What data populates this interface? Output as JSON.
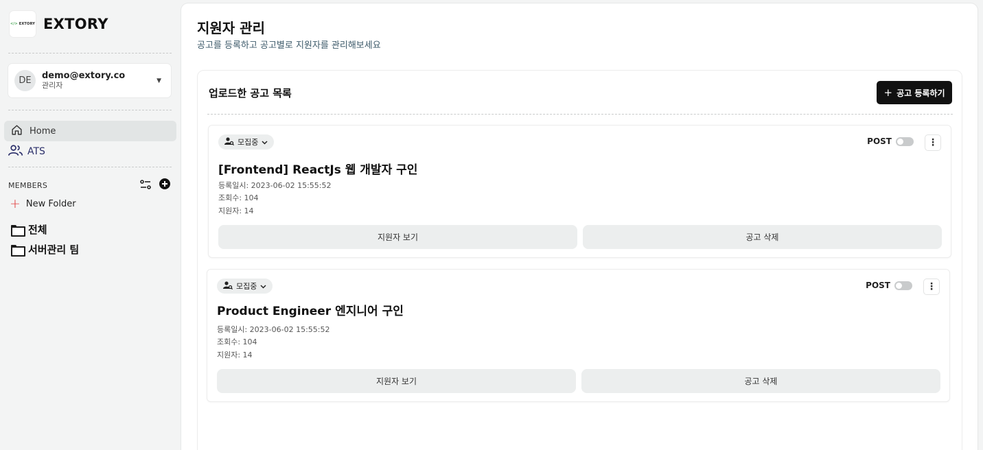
{
  "brand": {
    "logo_text": "EXTORY",
    "logo_mark": "</> EXTORY"
  },
  "user": {
    "initials": "DE",
    "email": "demo@extory.co",
    "role": "관리자"
  },
  "nav": {
    "home_label": "Home",
    "ats_label": "ATS"
  },
  "members": {
    "title": "MEMBERS",
    "new_folder_label": "New Folder",
    "folders": [
      "전체",
      "서버관리 팀"
    ]
  },
  "page": {
    "title": "지원자 관리",
    "subtitle": "공고를 등록하고 공고별로 지원자를 관리해보세요"
  },
  "panel": {
    "title": "업로드한 공고 목록",
    "add_button_label": "공고 등록하기",
    "add_button_plus": "+"
  },
  "jobs": [
    {
      "status": "모집중",
      "title": "[Frontend] ReactJs 웹 개발자 구인",
      "registered": "등록일시: 2023-06-02 15:55:52",
      "views": "조회수: 104",
      "applicants": "지원자: 14",
      "post_label": "POST",
      "post_enabled": false,
      "view_button": "지원자 보기",
      "delete_button": "공고 삭제"
    },
    {
      "status": "모집중",
      "title": "Product Engineer 엔지니어 구인",
      "registered": "등록일시: 2023-06-02 15:55:52",
      "views": "조회수: 104",
      "applicants": "지원자: 14",
      "post_label": "POST",
      "post_enabled": false,
      "view_button": "지원자 보기",
      "delete_button": "공고 삭제"
    }
  ],
  "colors": {
    "background": "#f3f4f4",
    "primary_button": "#111111",
    "new_folder_plus": "#e03a3a",
    "subtitle": "#3d5a6a"
  },
  "icons": {
    "home": "home-icon",
    "ats": "users-icon",
    "filter": "filter-icon",
    "add": "plus-circle-icon",
    "folder": "folder-icon",
    "status": "person-search-icon",
    "more": "more-vertical-icon"
  }
}
